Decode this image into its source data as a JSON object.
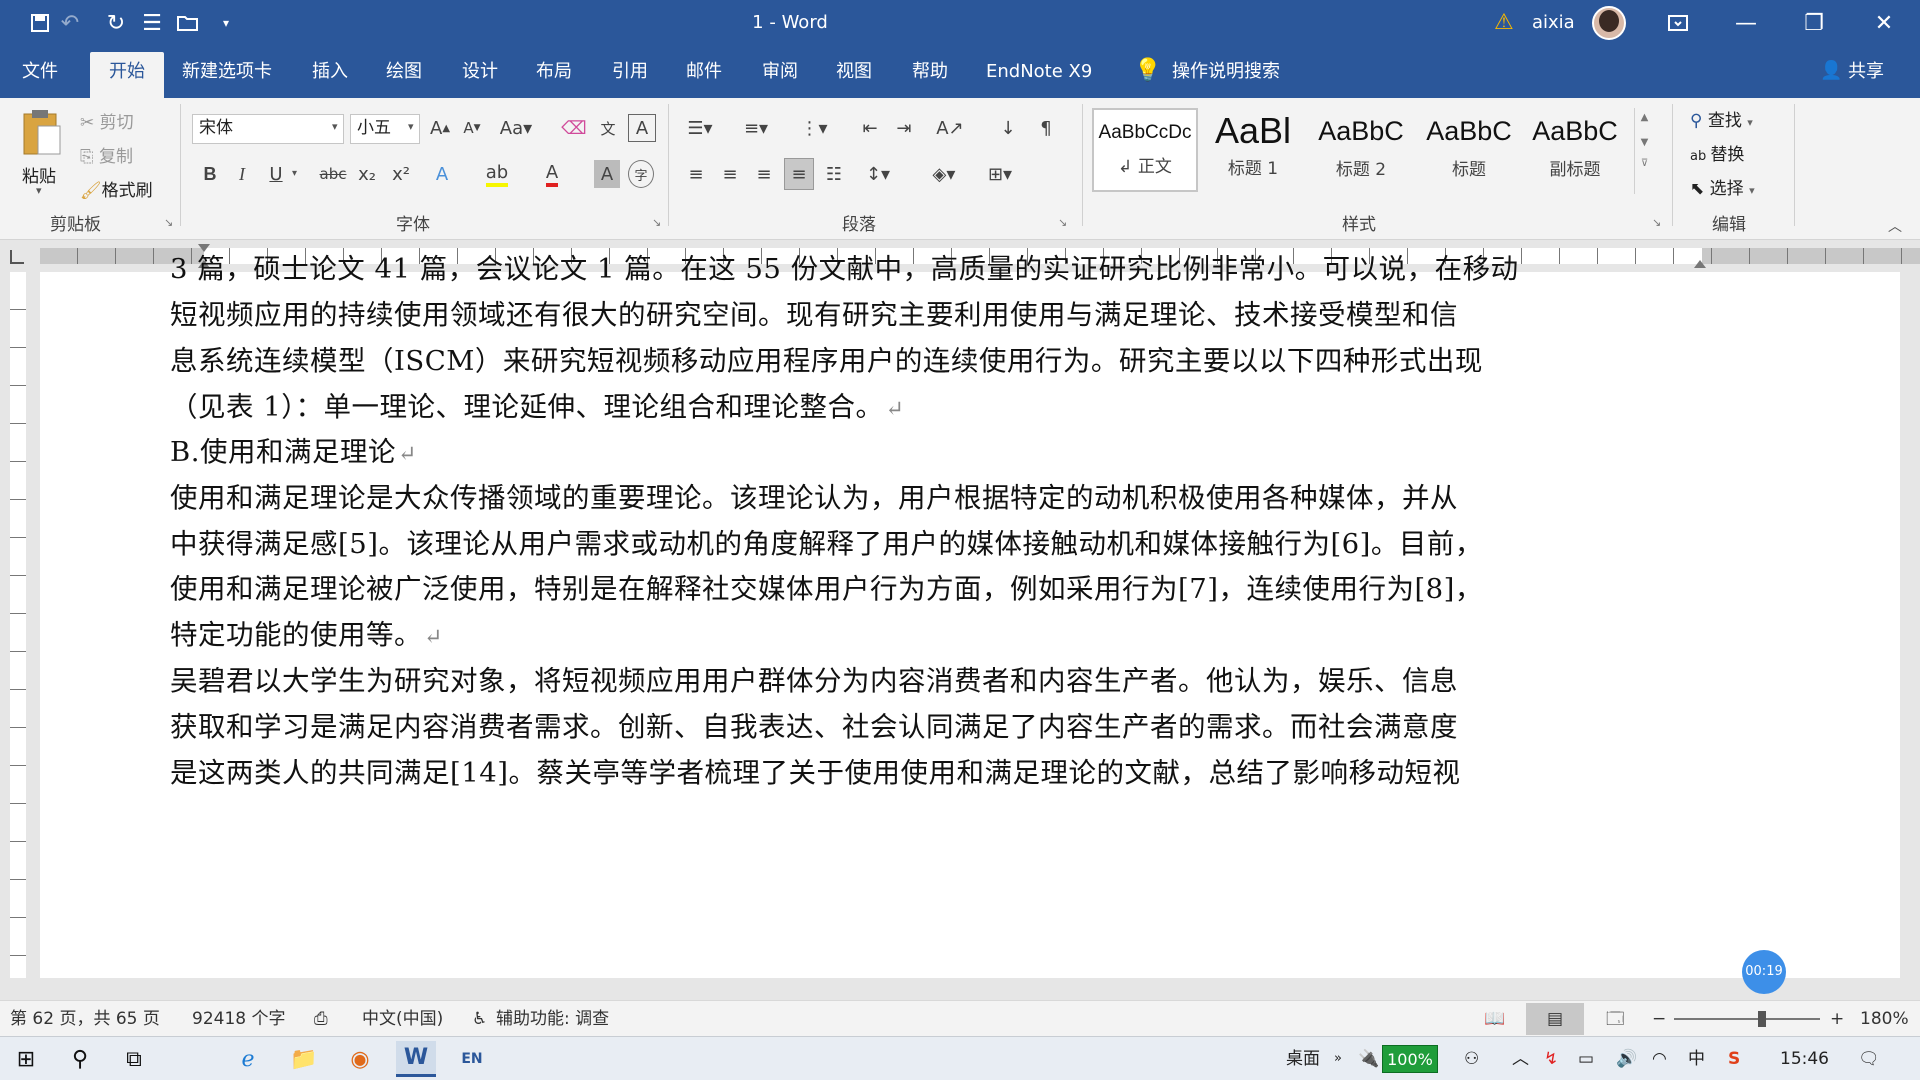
{
  "titlebar": {
    "doc_title": "1 - Word",
    "user_name": "aixia",
    "bg_color": "#2b579a"
  },
  "menu": {
    "tabs": [
      "文件",
      "开始",
      "新建选项卡",
      "插入",
      "绘图",
      "设计",
      "布局",
      "引用",
      "邮件",
      "审阅",
      "视图",
      "帮助",
      "EndNote X9"
    ],
    "search_label": "操作说明搜索",
    "share_label": "共享"
  },
  "ribbon": {
    "clipboard": {
      "paste": "粘贴",
      "cut": "剪切",
      "copy": "复制",
      "format_painter": "格式刷",
      "label": "剪贴板"
    },
    "font": {
      "family": "宋体",
      "size": "小五",
      "label": "字体",
      "bold": "B",
      "italic": "I",
      "underline": "U",
      "strike": "abc",
      "sub": "x₂",
      "sup": "x²"
    },
    "paragraph": {
      "label": "段落"
    },
    "styles": {
      "label": "样式",
      "items": [
        {
          "sample": "AaBbCcDc",
          "name": "↲ 正文"
        },
        {
          "sample": "AaBl",
          "name": "标题 1"
        },
        {
          "sample": "AaBbC",
          "name": "标题 2"
        },
        {
          "sample": "AaBbC",
          "name": "标题"
        },
        {
          "sample": "AaBbC",
          "name": "副标题"
        }
      ]
    },
    "editing": {
      "find": "查找",
      "replace": "替换",
      "select": "选择",
      "label": "编辑"
    }
  },
  "document": {
    "lines": [
      "3 篇，硕士论文 41 篇，会议论文 1 篇。在这 55 份文献中，高质量的实证研究比例非常小。可以说，在移动",
      "短视频应用的持续使用领域还有很大的研究空间。现有研究主要利用使用与满足理论、技术接受模型和信",
      "息系统连续模型（ISCM）来研究短视频移动应用程序用户的连续使用行为。研究主要以以下四种形式出现",
      "（见表 1）：单一理论、理论延伸、理论组合和理论整合。",
      "B.使用和满足理论",
      "使用和满足理论是大众传播领域的重要理论。该理论认为，用户根据特定的动机积极使用各种媒体，并从",
      "中获得满足感[5]。该理论从用户需求或动机的角度解释了用户的媒体接触动机和媒体接触行为[6]。目前，",
      "使用和满足理论被广泛使用，特别是在解释社交媒体用户行为方面，例如采用行为[7]，连续使用行为[8]，",
      "特定功能的使用等。",
      "吴碧君以大学生为研究对象，将短视频应用用户群体分为内容消费者和内容生产者。他认为，娱乐、信息",
      "获取和学习是满足内容消费者需求。创新、自我表达、社会认同满足了内容生产者的需求。而社会满意度",
      "是这两类人的共同满足[14]。蔡关亭等学者梳理了关于使用使用和满足理论的文献，总结了影响移动短视"
    ],
    "recording_badge": "00:19"
  },
  "statusbar": {
    "page_info": "第 62 页，共 65 页",
    "word_count": "92418 个字",
    "language": "中文(中国)",
    "accessibility": "辅助功能: 调查",
    "zoom": "180%",
    "zoom_level": 0.6
  },
  "taskbar": {
    "desktop": "桌面",
    "battery": "100%",
    "ime": "中",
    "time": "15:46"
  }
}
